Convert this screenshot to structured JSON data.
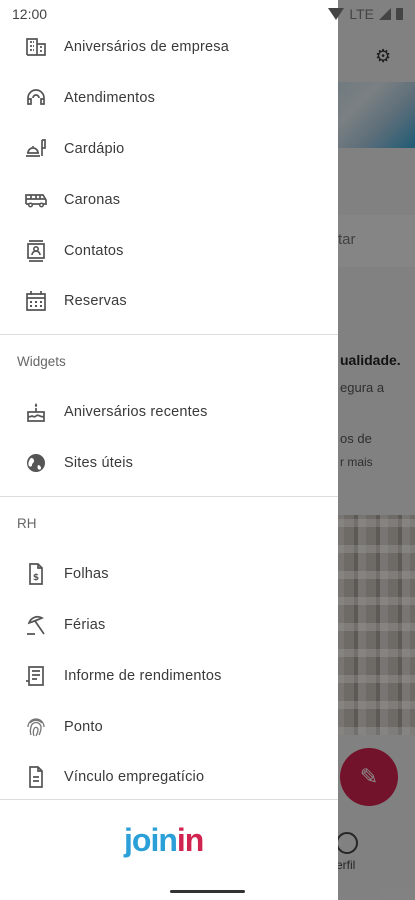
{
  "status_bar": {
    "time": "12:00",
    "network": "LTE"
  },
  "drawer": {
    "items_top": [
      {
        "label": "Aniversários de empresa",
        "icon": "building-icon"
      },
      {
        "label": "Atendimentos",
        "icon": "support-agent-icon"
      },
      {
        "label": "Cardápio",
        "icon": "menu-food-icon"
      },
      {
        "label": "Caronas",
        "icon": "bus-icon"
      },
      {
        "label": "Contatos",
        "icon": "contacts-icon"
      },
      {
        "label": "Reservas",
        "icon": "calendar-icon"
      }
    ],
    "widgets_header": "Widgets",
    "widgets": [
      {
        "label": "Aniversários recentes",
        "icon": "cake-icon"
      },
      {
        "label": "Sites úteis",
        "icon": "globe-icon"
      }
    ],
    "rh_header": "RH",
    "rh": [
      {
        "label": "Folhas",
        "icon": "payslip-icon"
      },
      {
        "label": "Férias",
        "icon": "beach-umbrella-icon"
      },
      {
        "label": "Informe de rendimentos",
        "icon": "receipt-icon"
      },
      {
        "label": "Ponto",
        "icon": "fingerprint-icon"
      },
      {
        "label": "Vínculo empregatício",
        "icon": "document-icon"
      }
    ],
    "logo": {
      "part1": "join",
      "part2": "in"
    }
  },
  "background": {
    "search_hint": "tar",
    "text1": "ualidade.",
    "text2": "egura a",
    "text3": "os de",
    "text4": "r mais",
    "profile_label": "erfil"
  },
  "colors": {
    "brand_blue": "#2a9fd8",
    "brand_red": "#d1234f"
  }
}
